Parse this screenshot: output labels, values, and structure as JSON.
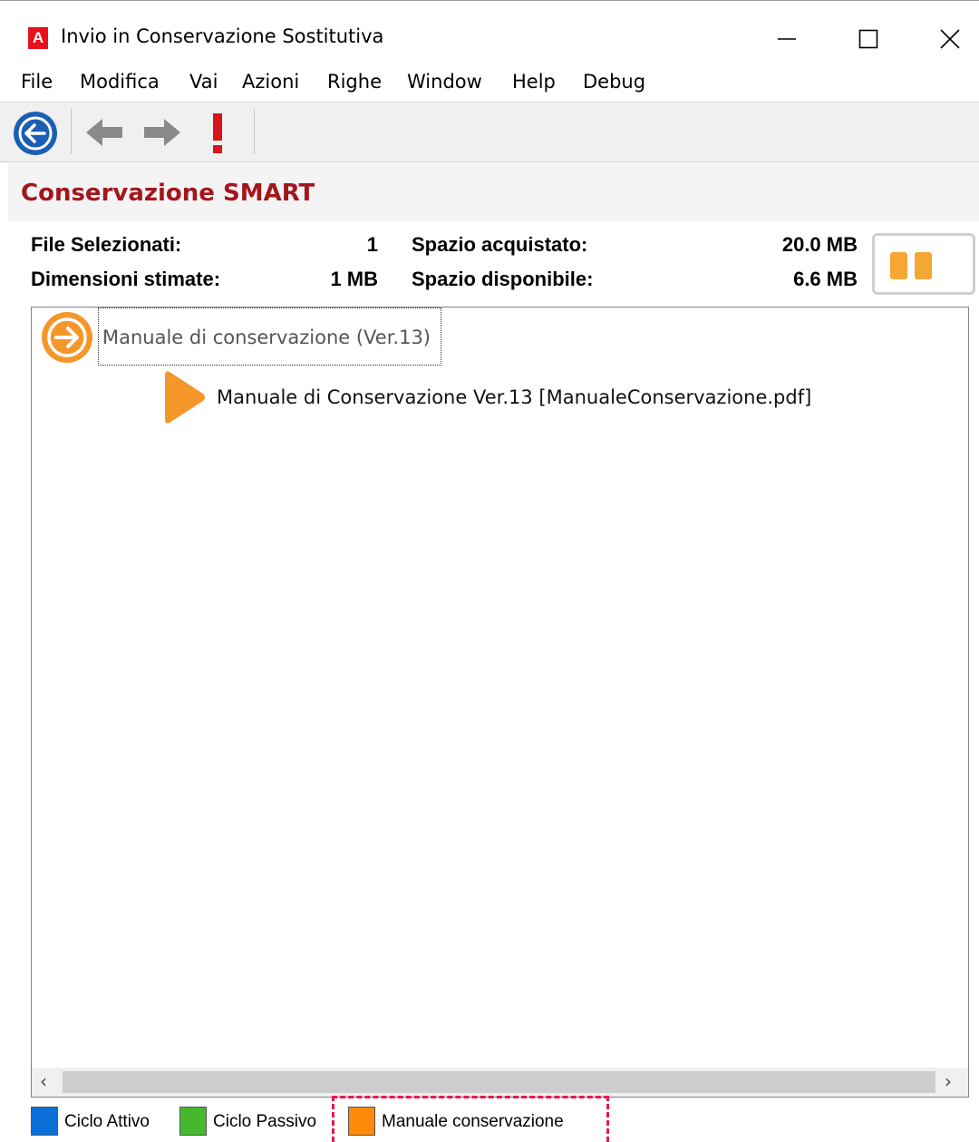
{
  "window": {
    "title": "Invio in Conservazione Sostitutiva",
    "app_icon_letter": "A"
  },
  "menu": [
    "File",
    "Modifica",
    "Vai",
    "Azioni",
    "Righe",
    "Window",
    "Help",
    "Debug"
  ],
  "header": {
    "title": "Conservazione SMART"
  },
  "info": {
    "files_selected_label": "File Selezionati:",
    "files_selected_value": "1",
    "estimated_size_label": "Dimensioni stimate:",
    "estimated_size_value": "1 MB",
    "space_purchased_label": "Spazio acquistato:",
    "space_purchased_value": "20.0 MB",
    "space_available_label": "Spazio disponibile:",
    "space_available_value": "6.6 MB"
  },
  "tree": {
    "root_label": "Manuale di conservazione (Ver.13)",
    "child_label": "Manuale di Conservazione Ver.13 [ManualeConservazione.pdf]"
  },
  "legend": [
    {
      "label": "Ciclo Attivo",
      "color": "#0a6fd8"
    },
    {
      "label": "Ciclo Passivo",
      "color": "#46b82e"
    },
    {
      "label": "Manuale conservazione",
      "color": "#ff8a0a"
    }
  ],
  "colors": {
    "accent_title": "#a3161c",
    "orange": "#f5962a",
    "back_button": "#1a5fb4",
    "exclamation": "#d8141c"
  }
}
